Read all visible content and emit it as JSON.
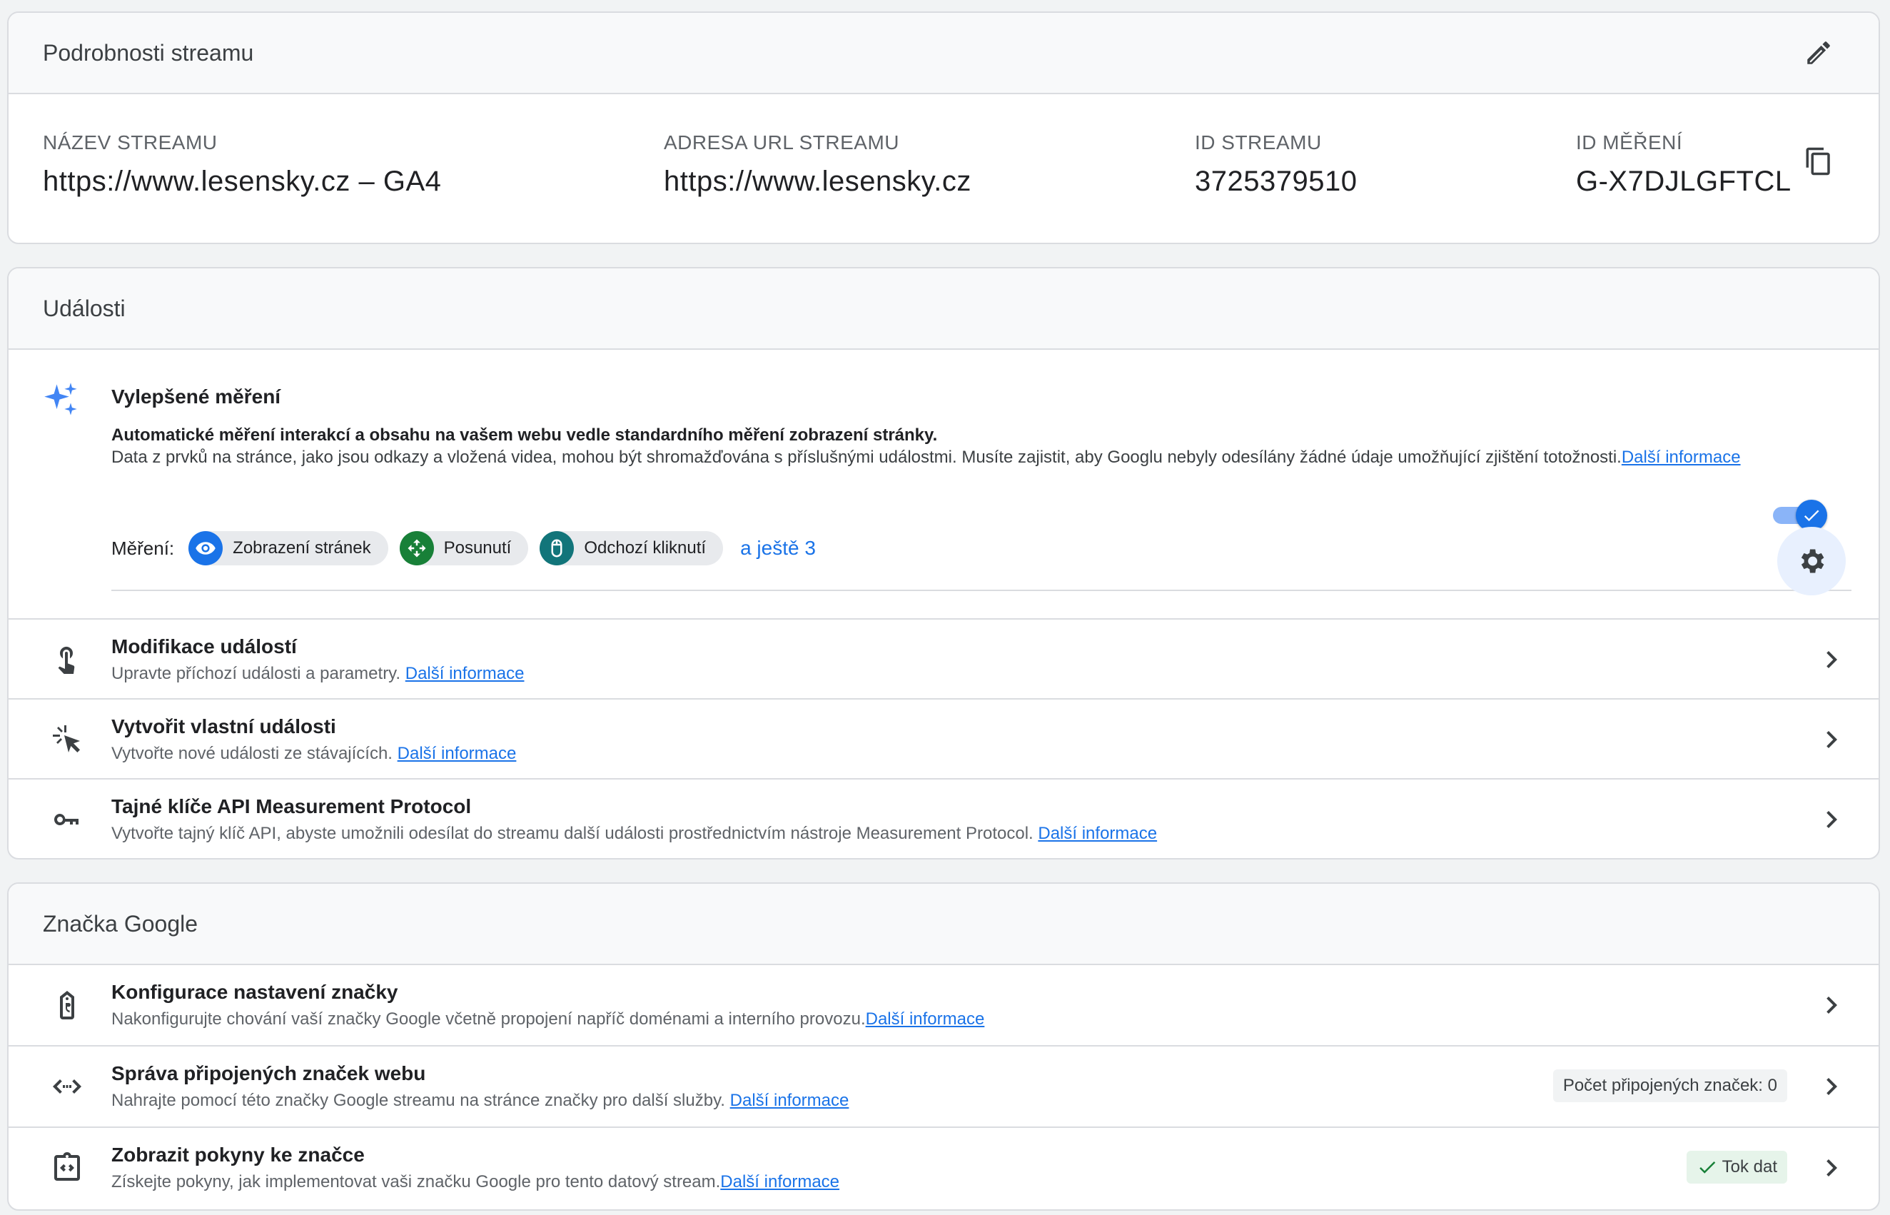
{
  "stream_details": {
    "title": "Podrobnosti streamu",
    "edit_icon": "pencil-icon",
    "fields": [
      {
        "label": "NÁZEV STREAMU",
        "value": "https://www.lesensky.cz – GA4"
      },
      {
        "label": "ADRESA URL STREAMU",
        "value": "https://www.lesensky.cz"
      },
      {
        "label": "ID STREAMU",
        "value": "3725379510"
      },
      {
        "label": "ID MĚŘENÍ",
        "value": "G-X7DJLGFTCL"
      }
    ],
    "copy_icon": "copy-icon"
  },
  "events": {
    "title": "Události",
    "enhanced": {
      "title": "Vylepšené měření",
      "desc_line1": "Automatické měření interakcí a obsahu na vašem webu vedle standardního měření zobrazení stránky.",
      "desc_line2": "Data z prvků na stránce, jako jsou odkazy a vložená videa, mohou být shromažďována s příslušnými událostmi. Musíte zajistit, aby Googlu nebyly odesílány žádné údaje umožňující zjištění totožnosti.",
      "more_link": "Další informace",
      "toggle_on": true,
      "measure_label": "Měření:",
      "chips": [
        {
          "label": "Zobrazení stránek",
          "color": "#1a73e8",
          "icon": "eye-icon"
        },
        {
          "label": "Posunutí",
          "color": "#188038",
          "icon": "scroll-icon"
        },
        {
          "label": "Odchozí kliknutí",
          "color": "#12757a",
          "icon": "mouse-icon"
        }
      ],
      "more_chips": "a ještě 3"
    },
    "rows": [
      {
        "title": "Modifikace událostí",
        "sub": "Upravte příchozí události a parametry. ",
        "link": "Další informace",
        "icon": "touch-icon"
      },
      {
        "title": "Vytvořit vlastní události",
        "sub": "Vytvořte nové události ze stávajících. ",
        "link": "Další informace",
        "icon": "sparkle-cursor-icon"
      },
      {
        "title": "Tajné klíče API Measurement Protocol",
        "sub": "Vytvořte tajný klíč API, abyste umožnili odesílat do streamu další události prostřednictvím nástroje Measurement Protocol. ",
        "link": "Další informace",
        "icon": "key-icon"
      }
    ]
  },
  "google_tag": {
    "title": "Značka Google",
    "rows": [
      {
        "title": "Konfigurace nastavení značky",
        "sub": "Nakonfigurujte chování vaší značky Google včetně propojení napříč doménami a interního provozu.",
        "link": "Další informace",
        "icon": "tag-icon"
      },
      {
        "title": "Správa připojených značek webu",
        "sub": "Nahrajte pomocí této značky Google streamu na stránce značky pro další služby. ",
        "link": "Další informace",
        "icon": "code-arrows-icon",
        "badge": "Počet připojených značek: 0"
      },
      {
        "title": "Zobrazit pokyny ke značce",
        "sub": "Získejte pokyny, jak implementovat vaši značku Google pro tento datový stream.",
        "link": "Další informace",
        "icon": "code-clipboard-icon",
        "badge": "Tok dat"
      }
    ]
  },
  "colors": {
    "link": "#1a73e8",
    "accent": "#1a73e8",
    "success": "#188038"
  }
}
